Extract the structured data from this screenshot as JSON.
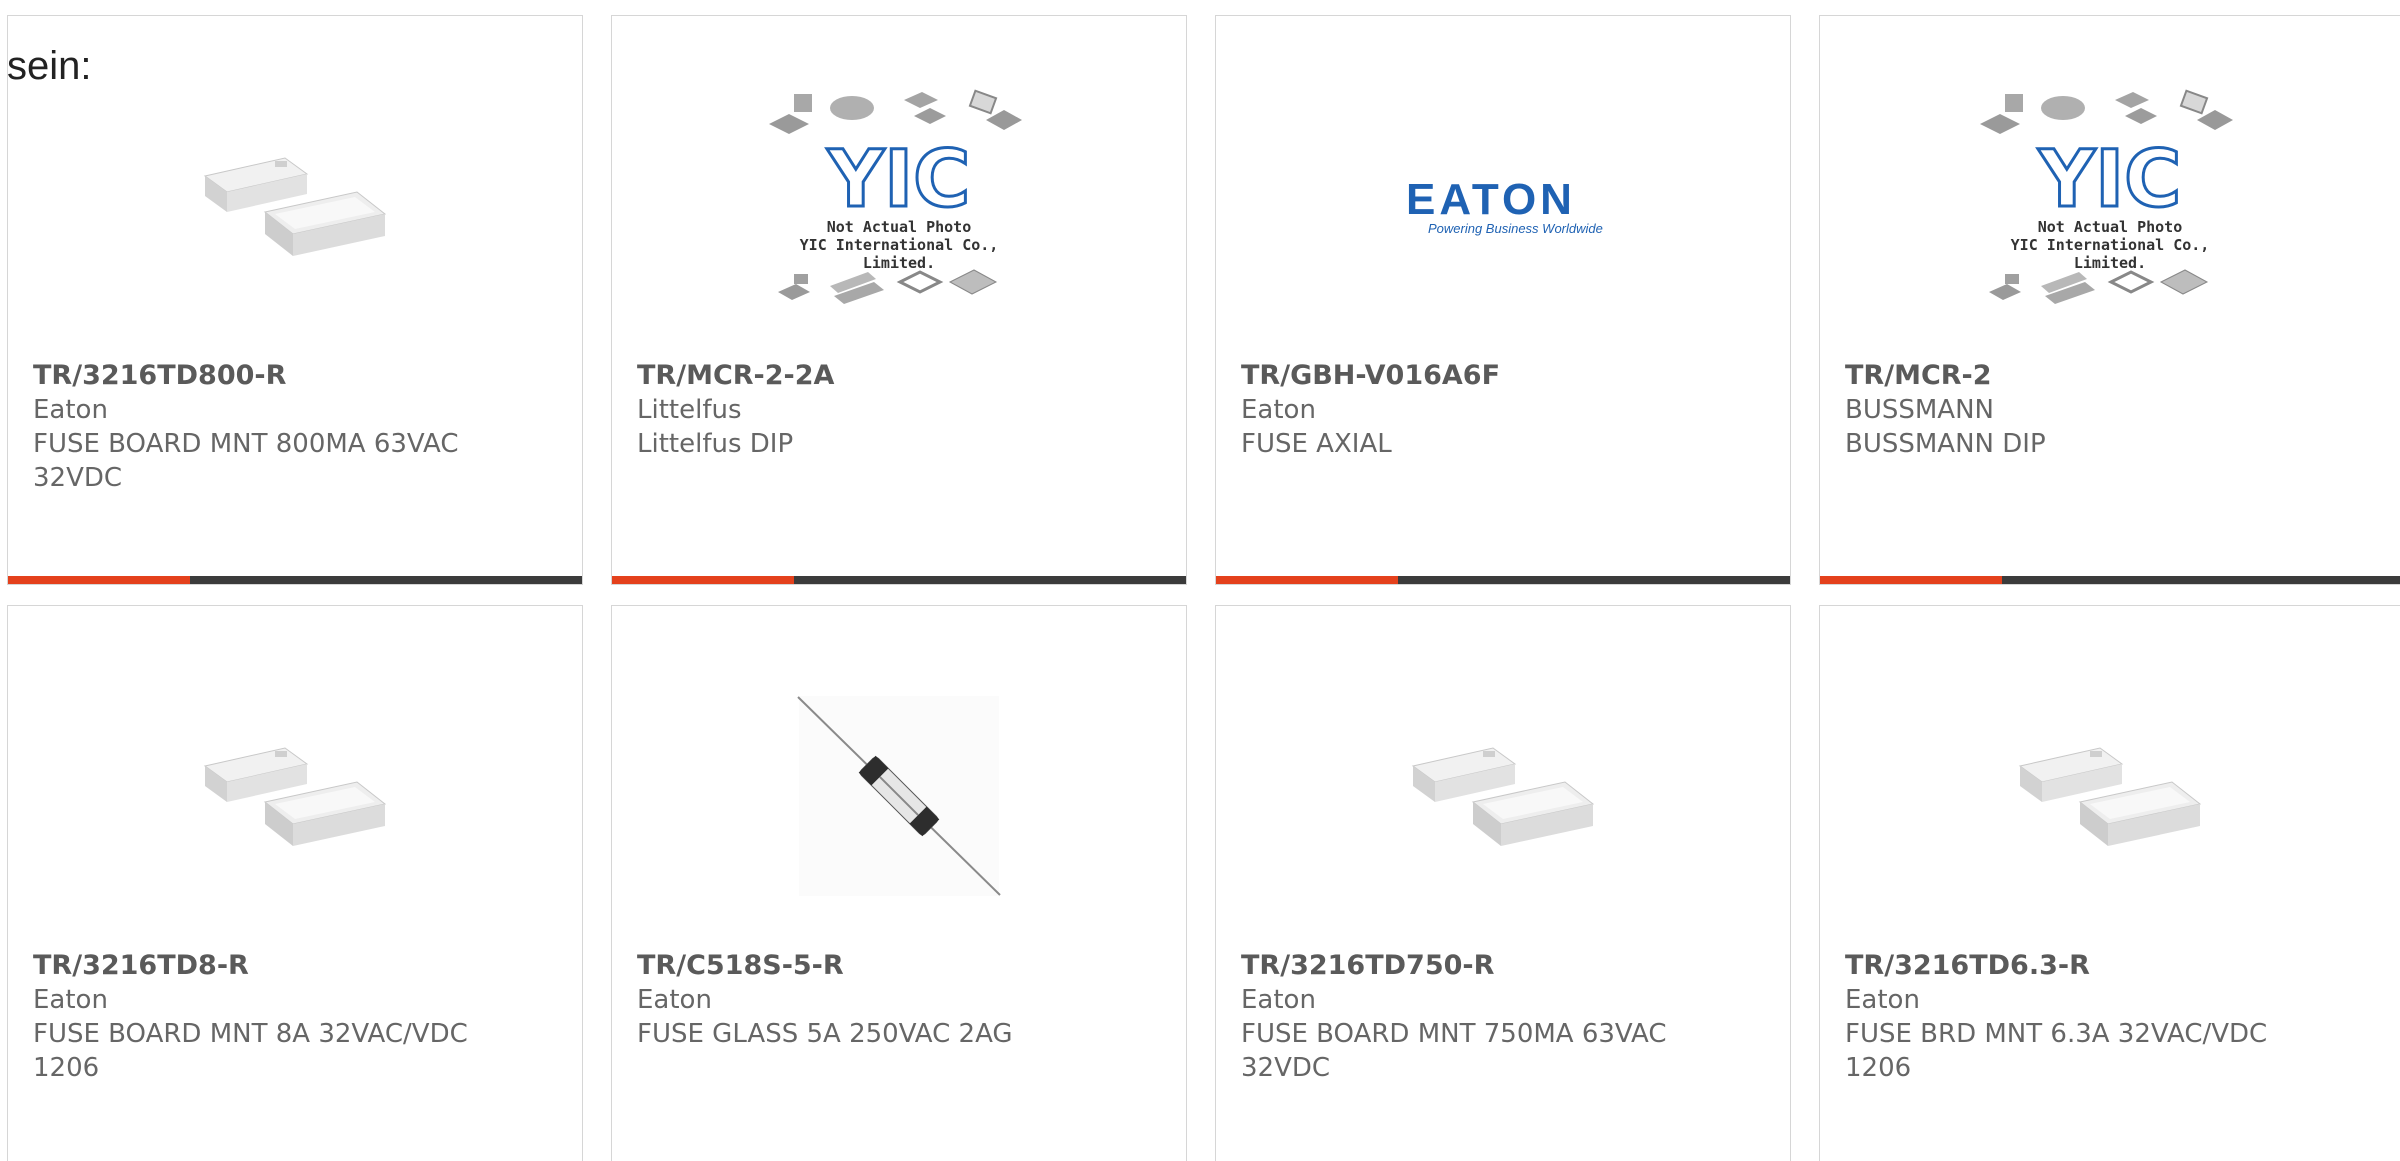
{
  "heading_fragment": "sein:",
  "products": [
    {
      "part_number": "TR/3216TD800-R",
      "manufacturer": "Eaton",
      "description": "FUSE BOARD MNT 800MA 63VAC 32VDC",
      "image": "smd-fuse-image"
    },
    {
      "part_number": "TR/MCR-2-2A",
      "manufacturer": "Littelfus",
      "description": "Littelfus DIP",
      "image": "not-actual-photo-placeholder"
    },
    {
      "part_number": "TR/GBH-V016A6F",
      "manufacturer": "Eaton",
      "description": "FUSE AXIAL",
      "image": "eaton-logo"
    },
    {
      "part_number": "TR/MCR-2",
      "manufacturer": "BUSSMANN",
      "description": "BUSSMANN DIP",
      "image": "not-actual-photo-placeholder"
    },
    {
      "part_number": "TR/3216TD8-R",
      "manufacturer": "Eaton",
      "description": "FUSE BOARD MNT 8A 32VAC/VDC 1206",
      "image": "smd-fuse-image"
    },
    {
      "part_number": "TR/C518S-5-R",
      "manufacturer": "Eaton",
      "description": "FUSE GLASS 5A 250VAC 2AG",
      "image": "glass-fuse-image"
    },
    {
      "part_number": "TR/3216TD750-R",
      "manufacturer": "Eaton",
      "description": "FUSE BOARD MNT 750MA 63VAC 32VDC",
      "image": "smd-fuse-image"
    },
    {
      "part_number": "TR/3216TD6.3-R",
      "manufacturer": "Eaton",
      "description": "FUSE BRD MNT 6.3A 32VAC/VDC 1206",
      "image": "smd-fuse-image"
    }
  ],
  "placeholder": {
    "line1": "Not Actual Photo",
    "line2": "YIC International Co., Limited.",
    "logo_text": "YIC"
  },
  "eaton_logo": {
    "wordmark": "EATON",
    "tagline": "Powering Business Worldwide"
  },
  "colors": {
    "accent": "#e4411c",
    "bar_dark": "#3b3b3b",
    "eaton_blue": "#1f62b3",
    "border": "#d6d6d6"
  }
}
